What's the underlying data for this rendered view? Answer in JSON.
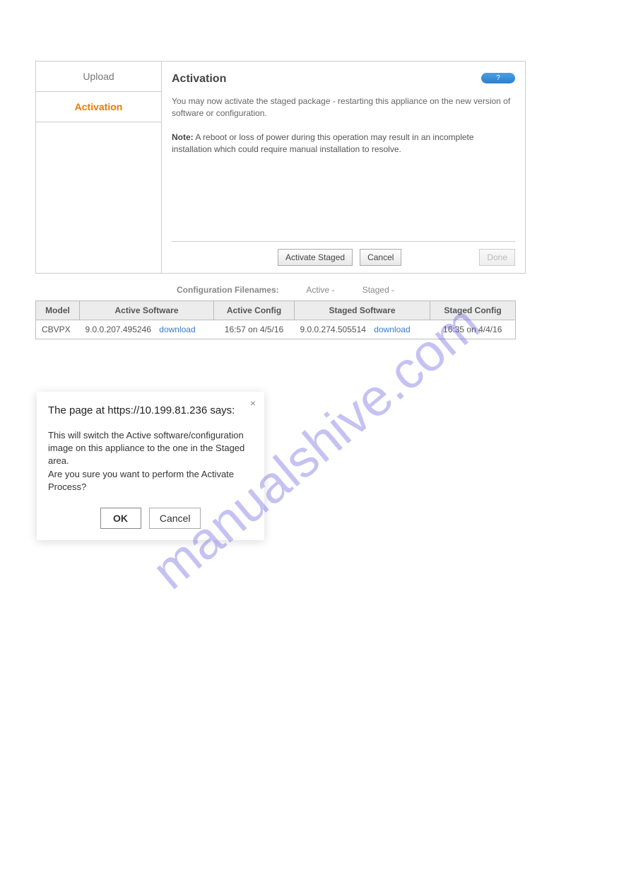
{
  "sidebar": {
    "upload": "Upload",
    "activation": "Activation"
  },
  "main": {
    "title": "Activation",
    "help_glyph": "?",
    "intro": "You may now activate the staged package - restarting this appliance on the new version of software or configuration.",
    "note_label": "Note:",
    "note_text": " A reboot or loss of power during this operation may result in an incomplete installation which could require manual installation to resolve.",
    "btn_activate": "Activate Staged",
    "btn_cancel": "Cancel",
    "btn_done": "Done"
  },
  "config": {
    "label": "Configuration Filenames:",
    "active": "Active -",
    "staged": "Staged -"
  },
  "table": {
    "headers": {
      "model": "Model",
      "active_sw": "Active Software",
      "active_cfg": "Active Config",
      "staged_sw": "Staged Software",
      "staged_cfg": "Staged Config"
    },
    "row": {
      "model": "CBVPX",
      "active_sw": "9.0.0.207.495246",
      "active_sw_dl": "download",
      "active_cfg": "16:57 on 4/5/16",
      "staged_sw": "9.0.0.274.505514",
      "staged_sw_dl": "download",
      "staged_cfg": "16:35 on 4/4/16"
    }
  },
  "dialog": {
    "title": "The page at https://10.199.81.236 says:",
    "line1": "This will switch the Active software/configuration image on this appliance to the one in the Staged area.",
    "line2": "Are you sure you want to perform the Activate Process?",
    "ok": "OK",
    "cancel": "Cancel",
    "close": "×"
  },
  "watermark": "manualshive.com"
}
